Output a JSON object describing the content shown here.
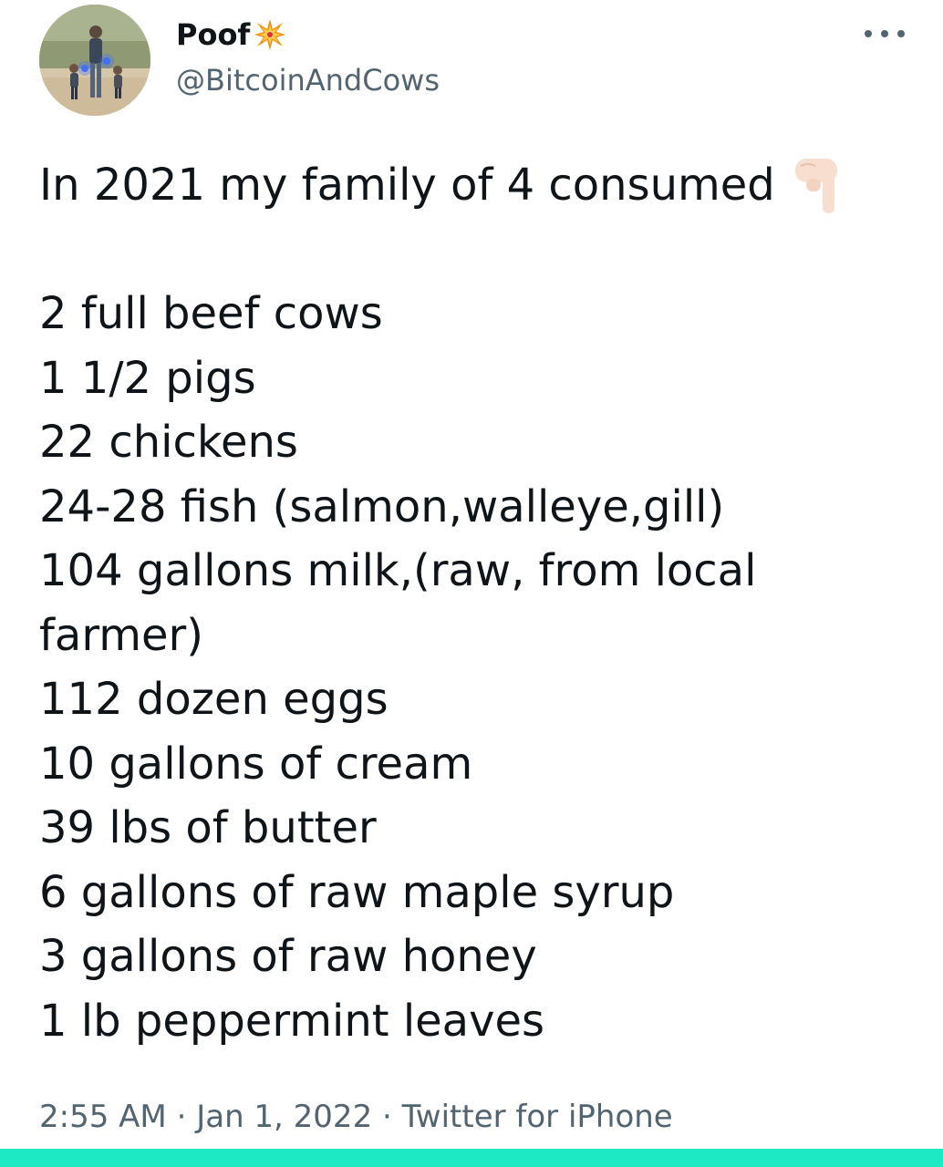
{
  "user": {
    "display_name": "Poof",
    "name_emoji": "collision-icon",
    "handle": "@BitcoinAndCows"
  },
  "tweet": {
    "intro": "In 2021 my family of 4 consumed",
    "intro_emoji": "backhand-index-pointing-down-icon",
    "items": [
      "2 full beef cows",
      "1 1/2 pigs",
      "22 chickens",
      "24-28 fish (salmon,walleye,gill)",
      "104 gallons milk,(raw, from local",
      "farmer)",
      "112 dozen eggs",
      "10 gallons of cream",
      "39 lbs of butter",
      "6 gallons of raw maple syrup",
      "3 gallons of raw honey",
      "1 lb peppermint leaves"
    ]
  },
  "meta": {
    "time": "2:55 AM",
    "separator": "·",
    "date": "Jan 1, 2022",
    "source": "Twitter for iPhone"
  },
  "colors": {
    "text": "#0f1419",
    "secondary": "#536471",
    "bottom_bar": "#1de9c5"
  }
}
